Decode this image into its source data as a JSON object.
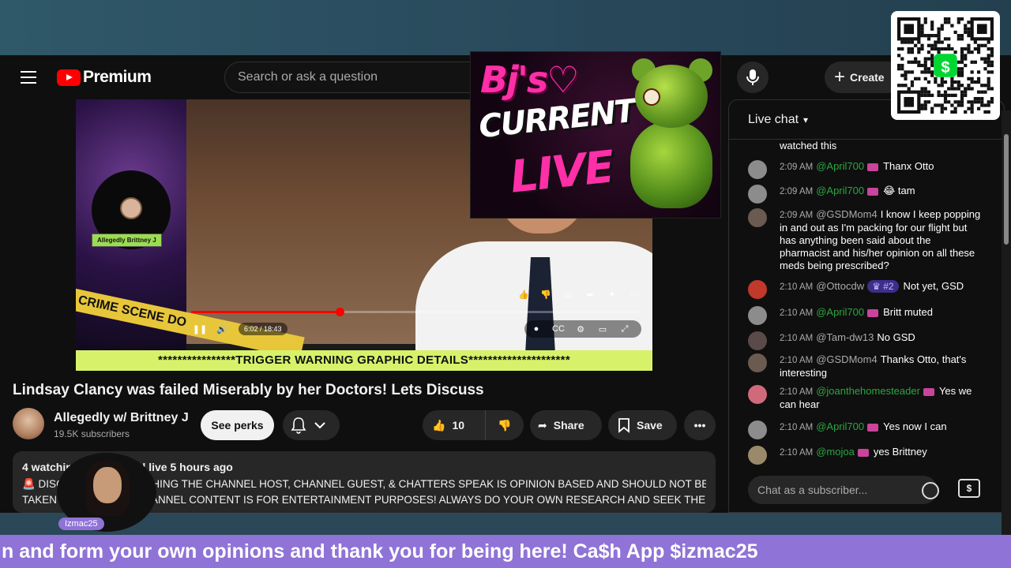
{
  "masthead": {
    "logo_text": "Premium",
    "search_placeholder": "Search or ask a question",
    "create_label": "Create"
  },
  "video": {
    "overlay_name": "Allegedly Brittney J",
    "crime_tape_text": "CRIME SCENE DO",
    "warning_text": "****************TRIGGER WARNING GRAPHIC DETAILS*********************",
    "time_display": "6:02 / 18:43",
    "progress_fraction": 0.33
  },
  "overlay_logo": {
    "line1": "Bj's♡",
    "line2": "CURRENT",
    "line3": "LIVE"
  },
  "meta": {
    "title": "Lindsay Clancy was failed Miserably by her Doctors! Lets Discuss",
    "channel_name": "Allegedly w/ Brittney J",
    "subscribers": "19.5K subscribers",
    "perks_label": "See perks",
    "likes": "10",
    "share_label": "Share",
    "save_label": "Save"
  },
  "description": {
    "meta_line": "4 watching now  Started live 5 hours ago",
    "line1": "🚨 DISCLAIMER: EVERYTHING THE CHANNEL HOST, CHANNEL GUEST, & CHATTERS SPEAK IS OPINION BASED AND SHOULD NOT BE",
    "line2": "TAKEN AS FACT. THIS CHANNEL CONTENT IS FOR ENTERTAINMENT PURPOSES!  ALWAYS DO YOUR OWN RESEARCH AND SEEK THE"
  },
  "chat": {
    "title": "Live chat",
    "input_placeholder": "Chat as a subscriber...",
    "messages": [
      {
        "time": "",
        "author": "",
        "text": "watched this"
      },
      {
        "time": "2:09 AM",
        "author": "@April700",
        "text": "Thanx Otto"
      },
      {
        "time": "2:09 AM",
        "author": "@April700",
        "text": "😂 tam"
      },
      {
        "time": "2:09 AM",
        "author": "@GSDMom4",
        "text": "I know I keep popping in and out as I'm packing for our flight but has anything been said about the pharmacist and his/her opinion on all these meds being prescribed?"
      },
      {
        "time": "2:10 AM",
        "author": "@Ottocdw",
        "badge": "#2",
        "text": "Not yet, GSD"
      },
      {
        "time": "2:10 AM",
        "author": "@April700",
        "text": "Britt muted"
      },
      {
        "time": "2:10 AM",
        "author": "@Tam-dw13",
        "text": "No GSD"
      },
      {
        "time": "2:10 AM",
        "author": "@GSDMom4",
        "text": "Thanks Otto, that's interesting"
      },
      {
        "time": "2:10 AM",
        "author": "@joanthehomesteader",
        "text": "Yes we can hear"
      },
      {
        "time": "2:10 AM",
        "author": "@April700",
        "text": "Yes now I can"
      },
      {
        "time": "2:10 AM",
        "author": "@mojoa",
        "text": "yes Brittney"
      }
    ]
  },
  "streamer": {
    "label": "Izmac25"
  },
  "ticker": {
    "text": "n and form your own opinions and thank you for being here! Ca$h App $izmac25"
  },
  "colors": {
    "youtube_red": "#ff0000",
    "member_green": "#2ba640",
    "ticker_purple": "#8f73d6",
    "warning_yellow": "#d7f26a",
    "logo_pink": "#ff2fa8"
  }
}
